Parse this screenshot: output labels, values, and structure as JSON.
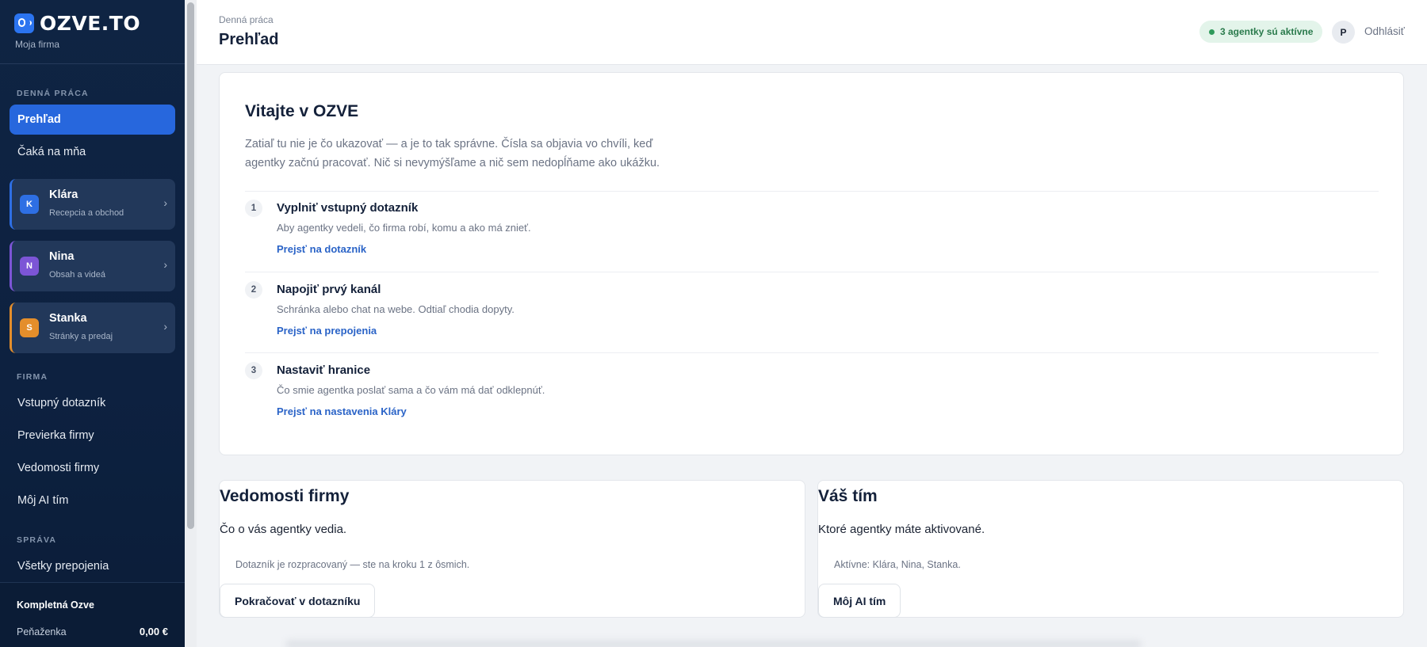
{
  "brand": {
    "name": "OZVE.TO",
    "sub": "Moja firma"
  },
  "sidebar": {
    "sections": {
      "daily": "DENNÁ PRÁCA",
      "firm": "FIRMA",
      "admin": "SPRÁVA"
    },
    "daily_items": [
      {
        "label": "Prehľad",
        "active": true
      },
      {
        "label": "Čaká na mňa",
        "active": false
      }
    ],
    "agents": [
      {
        "initial": "K",
        "name": "Klára",
        "role": "Recepcia a obchod",
        "color": "#2e6fe4"
      },
      {
        "initial": "N",
        "name": "Nina",
        "role": "Obsah a videá",
        "color": "#7c55d6"
      },
      {
        "initial": "S",
        "name": "Stanka",
        "role": "Stránky a predaj",
        "color": "#e48e2b"
      }
    ],
    "firm_items": [
      {
        "label": "Vstupný dotazník"
      },
      {
        "label": "Previerka firmy"
      },
      {
        "label": "Vedomosti firmy"
      },
      {
        "label": "Môj AI tím"
      }
    ],
    "admin_items": [
      {
        "label": "Všetky prepojenia"
      }
    ],
    "plan": "Kompletná Ozve",
    "wallet_label": "Peňaženka",
    "wallet_value": "0,00 €"
  },
  "header": {
    "breadcrumb": "Denná práca",
    "title": "Prehľad",
    "status": "3 agentky sú aktívne",
    "avatar": "P",
    "logout": "Odhlásiť"
  },
  "welcome": {
    "title": "Vitajte v OZVE",
    "text": "Zatiaľ tu nie je čo ukazovať — a je to tak správne. Čísla sa objavia vo chvíli, keď agentky začnú pracovať. Nič si nevymýšľame a nič sem nedopĺňame ako ukážku.",
    "steps": [
      {
        "num": "1",
        "title": "Vyplniť vstupný dotazník",
        "desc": "Aby agentky vedeli, čo firma robí, komu a ako má znieť.",
        "link": "Prejsť na dotazník"
      },
      {
        "num": "2",
        "title": "Napojiť prvý kanál",
        "desc": "Schránka alebo chat na webe. Odtiaľ chodia dopyty.",
        "link": "Prejsť na prepojenia"
      },
      {
        "num": "3",
        "title": "Nastaviť hranice",
        "desc": "Čo smie agentka poslať sama a čo vám má dať odklepnúť.",
        "link": "Prejsť na nastavenia Kláry"
      }
    ]
  },
  "cards": {
    "knowledge": {
      "title": "Vedomosti firmy",
      "sub": "Čo o vás agentky vedia.",
      "note": "Dotazník je rozpracovaný — ste na kroku 1 z ôsmich.",
      "button": "Pokračovať v dotazníku"
    },
    "team": {
      "title": "Váš tím",
      "sub": "Ktoré agentky máte aktivované.",
      "note": "Aktívne: Klára, Nina, Stanka.",
      "button": "Môj AI tím"
    }
  }
}
